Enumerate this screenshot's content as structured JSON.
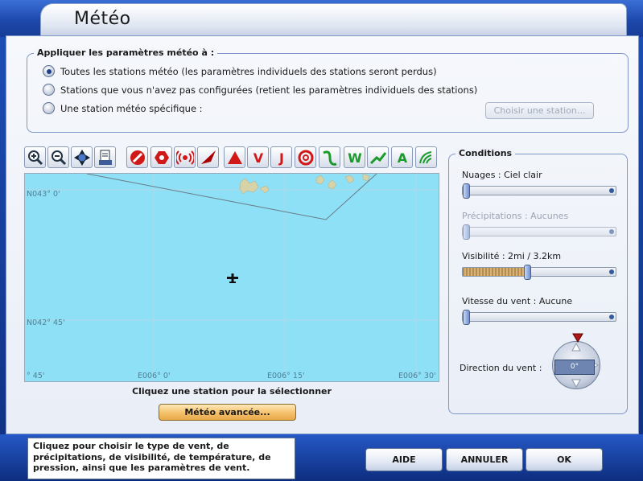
{
  "window": {
    "title": "Météo"
  },
  "apply_group": {
    "legend": "Appliquer les paramètres météo à :",
    "options": [
      {
        "label": "Toutes les stations météo (les paramètres individuels des stations seront perdus)",
        "selected": true
      },
      {
        "label": "Stations que vous n'avez pas configurées (retient les paramètres individuels des stations)",
        "selected": false
      },
      {
        "label": "Une station météo spécifique :",
        "selected": false
      }
    ],
    "choose_station_label": "Choisir une station..."
  },
  "toolbar": {
    "tools": [
      {
        "icon": "zoom-in-icon"
      },
      {
        "icon": "zoom-out-icon"
      },
      {
        "icon": "center-map-icon"
      },
      {
        "icon": "print-icon"
      },
      {
        "icon": "no-entry-icon"
      },
      {
        "icon": "hexagon-icon"
      },
      {
        "icon": "signal-icon"
      },
      {
        "icon": "plane-arrow-icon"
      },
      {
        "icon": "triangle-icon"
      },
      {
        "icon": "v-icon",
        "text": "V"
      },
      {
        "icon": "j-icon",
        "text": "J"
      },
      {
        "icon": "circle-route-icon"
      },
      {
        "icon": "route-icon"
      },
      {
        "icon": "w-icon",
        "text": "W"
      },
      {
        "icon": "airway-icon"
      },
      {
        "icon": "altitude-icon",
        "text": "A"
      },
      {
        "icon": "terrain-icon"
      }
    ]
  },
  "map": {
    "lat_labels": [
      "N043° 0'",
      "N042° 45'"
    ],
    "lon_labels": [
      "E006° 0'",
      "E006° 15'",
      "E006° 30'"
    ],
    "left_lon_partial": "° 45'",
    "caption": "Cliquez une station pour la sélectionner",
    "advanced_label": "Météo avancée..."
  },
  "conditions": {
    "legend": "Conditions",
    "clouds": {
      "label": "Nuages : Ciel clair",
      "value": 0.0
    },
    "precip": {
      "label": "Précipitations : Aucunes",
      "value": 0.0,
      "disabled": true
    },
    "visibility": {
      "label": "Visibilité : 2mi / 3.2km",
      "value": 0.42
    },
    "wind_speed": {
      "label": "Vitesse du vent : Aucune",
      "value": 0.0
    },
    "wind_dir": {
      "label": "Direction du vent :",
      "value": "0°"
    }
  },
  "tip": "Cliquez pour choisir le type de vent, de précipitations, de visibilité, de température, de pression, ainsi que les paramètres de vent.",
  "buttons": {
    "help": "AIDE",
    "cancel": "ANNULER",
    "ok": "OK"
  }
}
